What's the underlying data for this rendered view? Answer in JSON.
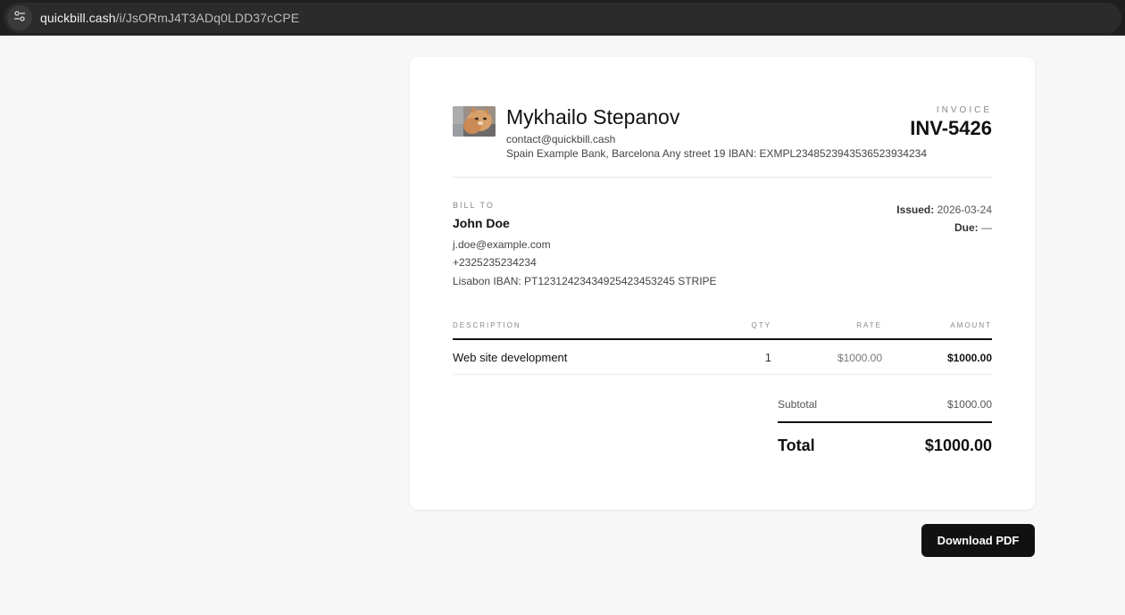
{
  "browser": {
    "url_host": "quickbill.cash",
    "url_path": "/i/JsORmJ4T3ADq0LDD37cCPE",
    "site_info_icon": "tune-icon"
  },
  "sender": {
    "name": "Mykhailo Stepanov",
    "email": "contact@quickbill.cash",
    "bank": "Spain Example Bank, Barcelona Any street 19 IBAN: EXMPL234852394353652393423​4",
    "avatar_icon": "cat-photo"
  },
  "invoice": {
    "label": "INVOICE",
    "number": "INV-5426",
    "issued_label": "Issued:",
    "issued_value": "2026-03-24",
    "due_label": "Due:",
    "due_value": "—"
  },
  "bill_to": {
    "label": "BILL TO",
    "name": "John Doe",
    "email": "j.doe@example.com",
    "phone": "+2325235234234",
    "bank": "Lisabon IBAN: PT123124234349254234532​45 STRIPE"
  },
  "table": {
    "headers": {
      "description": "DESCRIPTION",
      "qty": "QTY",
      "rate": "RATE",
      "amount": "AMOUNT"
    },
    "rows": [
      {
        "description": "Web site development",
        "qty": "1",
        "rate": "$1000.00",
        "amount": "$1000.00"
      }
    ]
  },
  "totals": {
    "subtotal_label": "Subtotal",
    "subtotal_value": "$1000.00",
    "total_label": "Total",
    "total_value": "$1000.00"
  },
  "actions": {
    "download_label": "Download PDF"
  }
}
